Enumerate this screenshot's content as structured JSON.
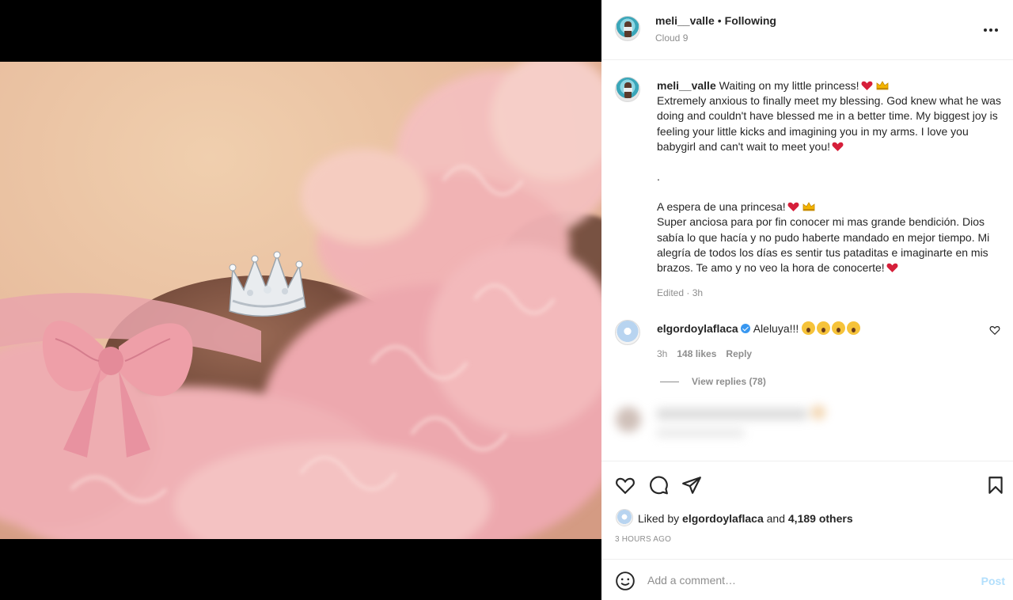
{
  "post": {
    "username": "meli__valle",
    "separator": "•",
    "follow_status": "Following",
    "location": "Cloud 9",
    "media_alt": "Baby bump wrapped in pink tulle with a silver tiara"
  },
  "caption": {
    "username": "meli__valle",
    "line_en_title": "Waiting on my little princess!",
    "body_en": "Extremely anxious to finally meet my blessing. God knew what he was doing and couldn't have blessed me in a better time. My biggest joy is feeling your little kicks and imagining you in my arms. I love you babygirl and can't wait to meet you!",
    "separator_dot": ".",
    "line_es_title": "A espera de una princesa!",
    "body_es": "Super anciosa para por fin conocer mi mas grande bendición. Dios sabía lo que hacía y no pudo haberte mandado en mejor tiempo. Mi alegría de todos los días es sentir tus pataditas e imaginarte en mis brazos. Te amo y no veo la hora de conocerte!",
    "meta": "Edited · 3h"
  },
  "comment": {
    "username": "elgordoylaflaca",
    "text": "Aleluya!!!",
    "time": "3h",
    "likes": "148 likes",
    "reply": "Reply",
    "view_replies": "View replies (78)"
  },
  "likes": {
    "prefix": "Liked by",
    "user": "elgordoylaflaca",
    "and": "and",
    "others": "4,189 others"
  },
  "timestamp": "3 HOURS AGO",
  "add_comment": {
    "placeholder": "Add a comment…",
    "post_label": "Post"
  },
  "icons": [
    "more-icon",
    "heart-icon",
    "comment-icon",
    "share-icon",
    "bookmark-icon",
    "smile-icon",
    "verified-icon",
    "red-heart-emoji",
    "crown-emoji",
    "scream-emoji"
  ],
  "colors": {
    "link": "#262626",
    "muted": "#8e8e8e",
    "post_disabled": "#b2dffc",
    "verified": "#3897f0"
  }
}
